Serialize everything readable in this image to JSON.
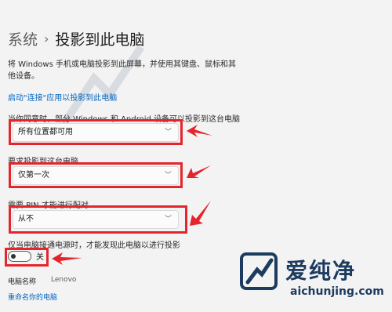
{
  "breadcrumb": {
    "root": "系统",
    "separator": "›",
    "title": "投影到此电脑"
  },
  "description": "将 Windows 手机或电脑投影到此屏幕，并使用其键盘、鼠标和其他设备。",
  "launch_link": "启动\"连接\"应用以投影到此电脑",
  "settings": [
    {
      "label": "当你同意时，部分 Windows 和 Android 设备可以投影到这台电脑",
      "value": "所有位置都可用"
    },
    {
      "label": "要求投影到这台电脑",
      "value": "仅第一次"
    },
    {
      "label": "需要 PIN 才能进行配对",
      "value": "从不"
    }
  ],
  "power": {
    "label": "仅当电脑接通电源时，才能发现此电脑以进行投影",
    "toggle_state": "关"
  },
  "pc_name": {
    "label": "电脑名称",
    "value": "Lenovo"
  },
  "rename_link": "重命名你的电脑",
  "watermark": {
    "cn": "爱纯净",
    "url": "aichunjing.com"
  },
  "colors": {
    "highlight": "#e4252d",
    "link": "#0067c0",
    "brand": "#1d3a5f"
  },
  "icons": {
    "dropdown": "chevron-down-icon",
    "annotation": "red-arrow-icon",
    "logo": "brand-logo-icon"
  }
}
